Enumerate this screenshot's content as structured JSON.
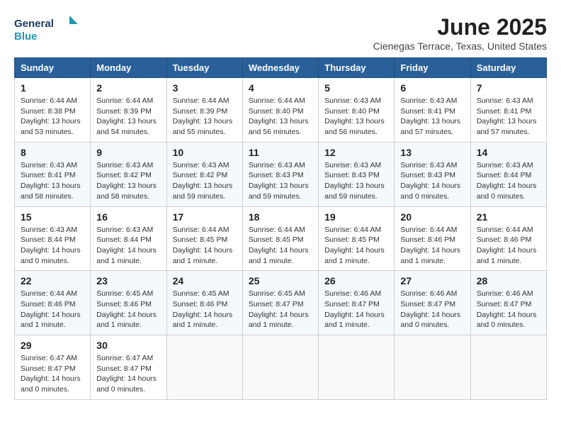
{
  "header": {
    "logo_line1": "General",
    "logo_line2": "Blue",
    "month": "June 2025",
    "location": "Cienegas Terrace, Texas, United States"
  },
  "days_of_week": [
    "Sunday",
    "Monday",
    "Tuesday",
    "Wednesday",
    "Thursday",
    "Friday",
    "Saturday"
  ],
  "weeks": [
    [
      {
        "day": 1,
        "sunrise": "6:44 AM",
        "sunset": "8:38 PM",
        "daylight": "13 hours and 53 minutes."
      },
      {
        "day": 2,
        "sunrise": "6:44 AM",
        "sunset": "8:39 PM",
        "daylight": "13 hours and 54 minutes."
      },
      {
        "day": 3,
        "sunrise": "6:44 AM",
        "sunset": "8:39 PM",
        "daylight": "13 hours and 55 minutes."
      },
      {
        "day": 4,
        "sunrise": "6:44 AM",
        "sunset": "8:40 PM",
        "daylight": "13 hours and 56 minutes."
      },
      {
        "day": 5,
        "sunrise": "6:43 AM",
        "sunset": "8:40 PM",
        "daylight": "13 hours and 56 minutes."
      },
      {
        "day": 6,
        "sunrise": "6:43 AM",
        "sunset": "8:41 PM",
        "daylight": "13 hours and 57 minutes."
      },
      {
        "day": 7,
        "sunrise": "6:43 AM",
        "sunset": "8:41 PM",
        "daylight": "13 hours and 57 minutes."
      }
    ],
    [
      {
        "day": 8,
        "sunrise": "6:43 AM",
        "sunset": "8:41 PM",
        "daylight": "13 hours and 58 minutes."
      },
      {
        "day": 9,
        "sunrise": "6:43 AM",
        "sunset": "8:42 PM",
        "daylight": "13 hours and 58 minutes."
      },
      {
        "day": 10,
        "sunrise": "6:43 AM",
        "sunset": "8:42 PM",
        "daylight": "13 hours and 59 minutes."
      },
      {
        "day": 11,
        "sunrise": "6:43 AM",
        "sunset": "8:43 PM",
        "daylight": "13 hours and 59 minutes."
      },
      {
        "day": 12,
        "sunrise": "6:43 AM",
        "sunset": "8:43 PM",
        "daylight": "13 hours and 59 minutes."
      },
      {
        "day": 13,
        "sunrise": "6:43 AM",
        "sunset": "8:43 PM",
        "daylight": "14 hours and 0 minutes."
      },
      {
        "day": 14,
        "sunrise": "6:43 AM",
        "sunset": "8:44 PM",
        "daylight": "14 hours and 0 minutes."
      }
    ],
    [
      {
        "day": 15,
        "sunrise": "6:43 AM",
        "sunset": "8:44 PM",
        "daylight": "14 hours and 0 minutes."
      },
      {
        "day": 16,
        "sunrise": "6:43 AM",
        "sunset": "8:44 PM",
        "daylight": "14 hours and 1 minute."
      },
      {
        "day": 17,
        "sunrise": "6:44 AM",
        "sunset": "8:45 PM",
        "daylight": "14 hours and 1 minute."
      },
      {
        "day": 18,
        "sunrise": "6:44 AM",
        "sunset": "8:45 PM",
        "daylight": "14 hours and 1 minute."
      },
      {
        "day": 19,
        "sunrise": "6:44 AM",
        "sunset": "8:45 PM",
        "daylight": "14 hours and 1 minute."
      },
      {
        "day": 20,
        "sunrise": "6:44 AM",
        "sunset": "8:46 PM",
        "daylight": "14 hours and 1 minute."
      },
      {
        "day": 21,
        "sunrise": "6:44 AM",
        "sunset": "8:46 PM",
        "daylight": "14 hours and 1 minute."
      }
    ],
    [
      {
        "day": 22,
        "sunrise": "6:44 AM",
        "sunset": "8:46 PM",
        "daylight": "14 hours and 1 minute."
      },
      {
        "day": 23,
        "sunrise": "6:45 AM",
        "sunset": "8:46 PM",
        "daylight": "14 hours and 1 minute."
      },
      {
        "day": 24,
        "sunrise": "6:45 AM",
        "sunset": "8:46 PM",
        "daylight": "14 hours and 1 minute."
      },
      {
        "day": 25,
        "sunrise": "6:45 AM",
        "sunset": "8:47 PM",
        "daylight": "14 hours and 1 minute."
      },
      {
        "day": 26,
        "sunrise": "6:46 AM",
        "sunset": "8:47 PM",
        "daylight": "14 hours and 1 minute."
      },
      {
        "day": 27,
        "sunrise": "6:46 AM",
        "sunset": "8:47 PM",
        "daylight": "14 hours and 0 minutes."
      },
      {
        "day": 28,
        "sunrise": "6:46 AM",
        "sunset": "8:47 PM",
        "daylight": "14 hours and 0 minutes."
      }
    ],
    [
      {
        "day": 29,
        "sunrise": "6:47 AM",
        "sunset": "8:47 PM",
        "daylight": "14 hours and 0 minutes."
      },
      {
        "day": 30,
        "sunrise": "6:47 AM",
        "sunset": "8:47 PM",
        "daylight": "14 hours and 0 minutes."
      },
      null,
      null,
      null,
      null,
      null
    ]
  ]
}
